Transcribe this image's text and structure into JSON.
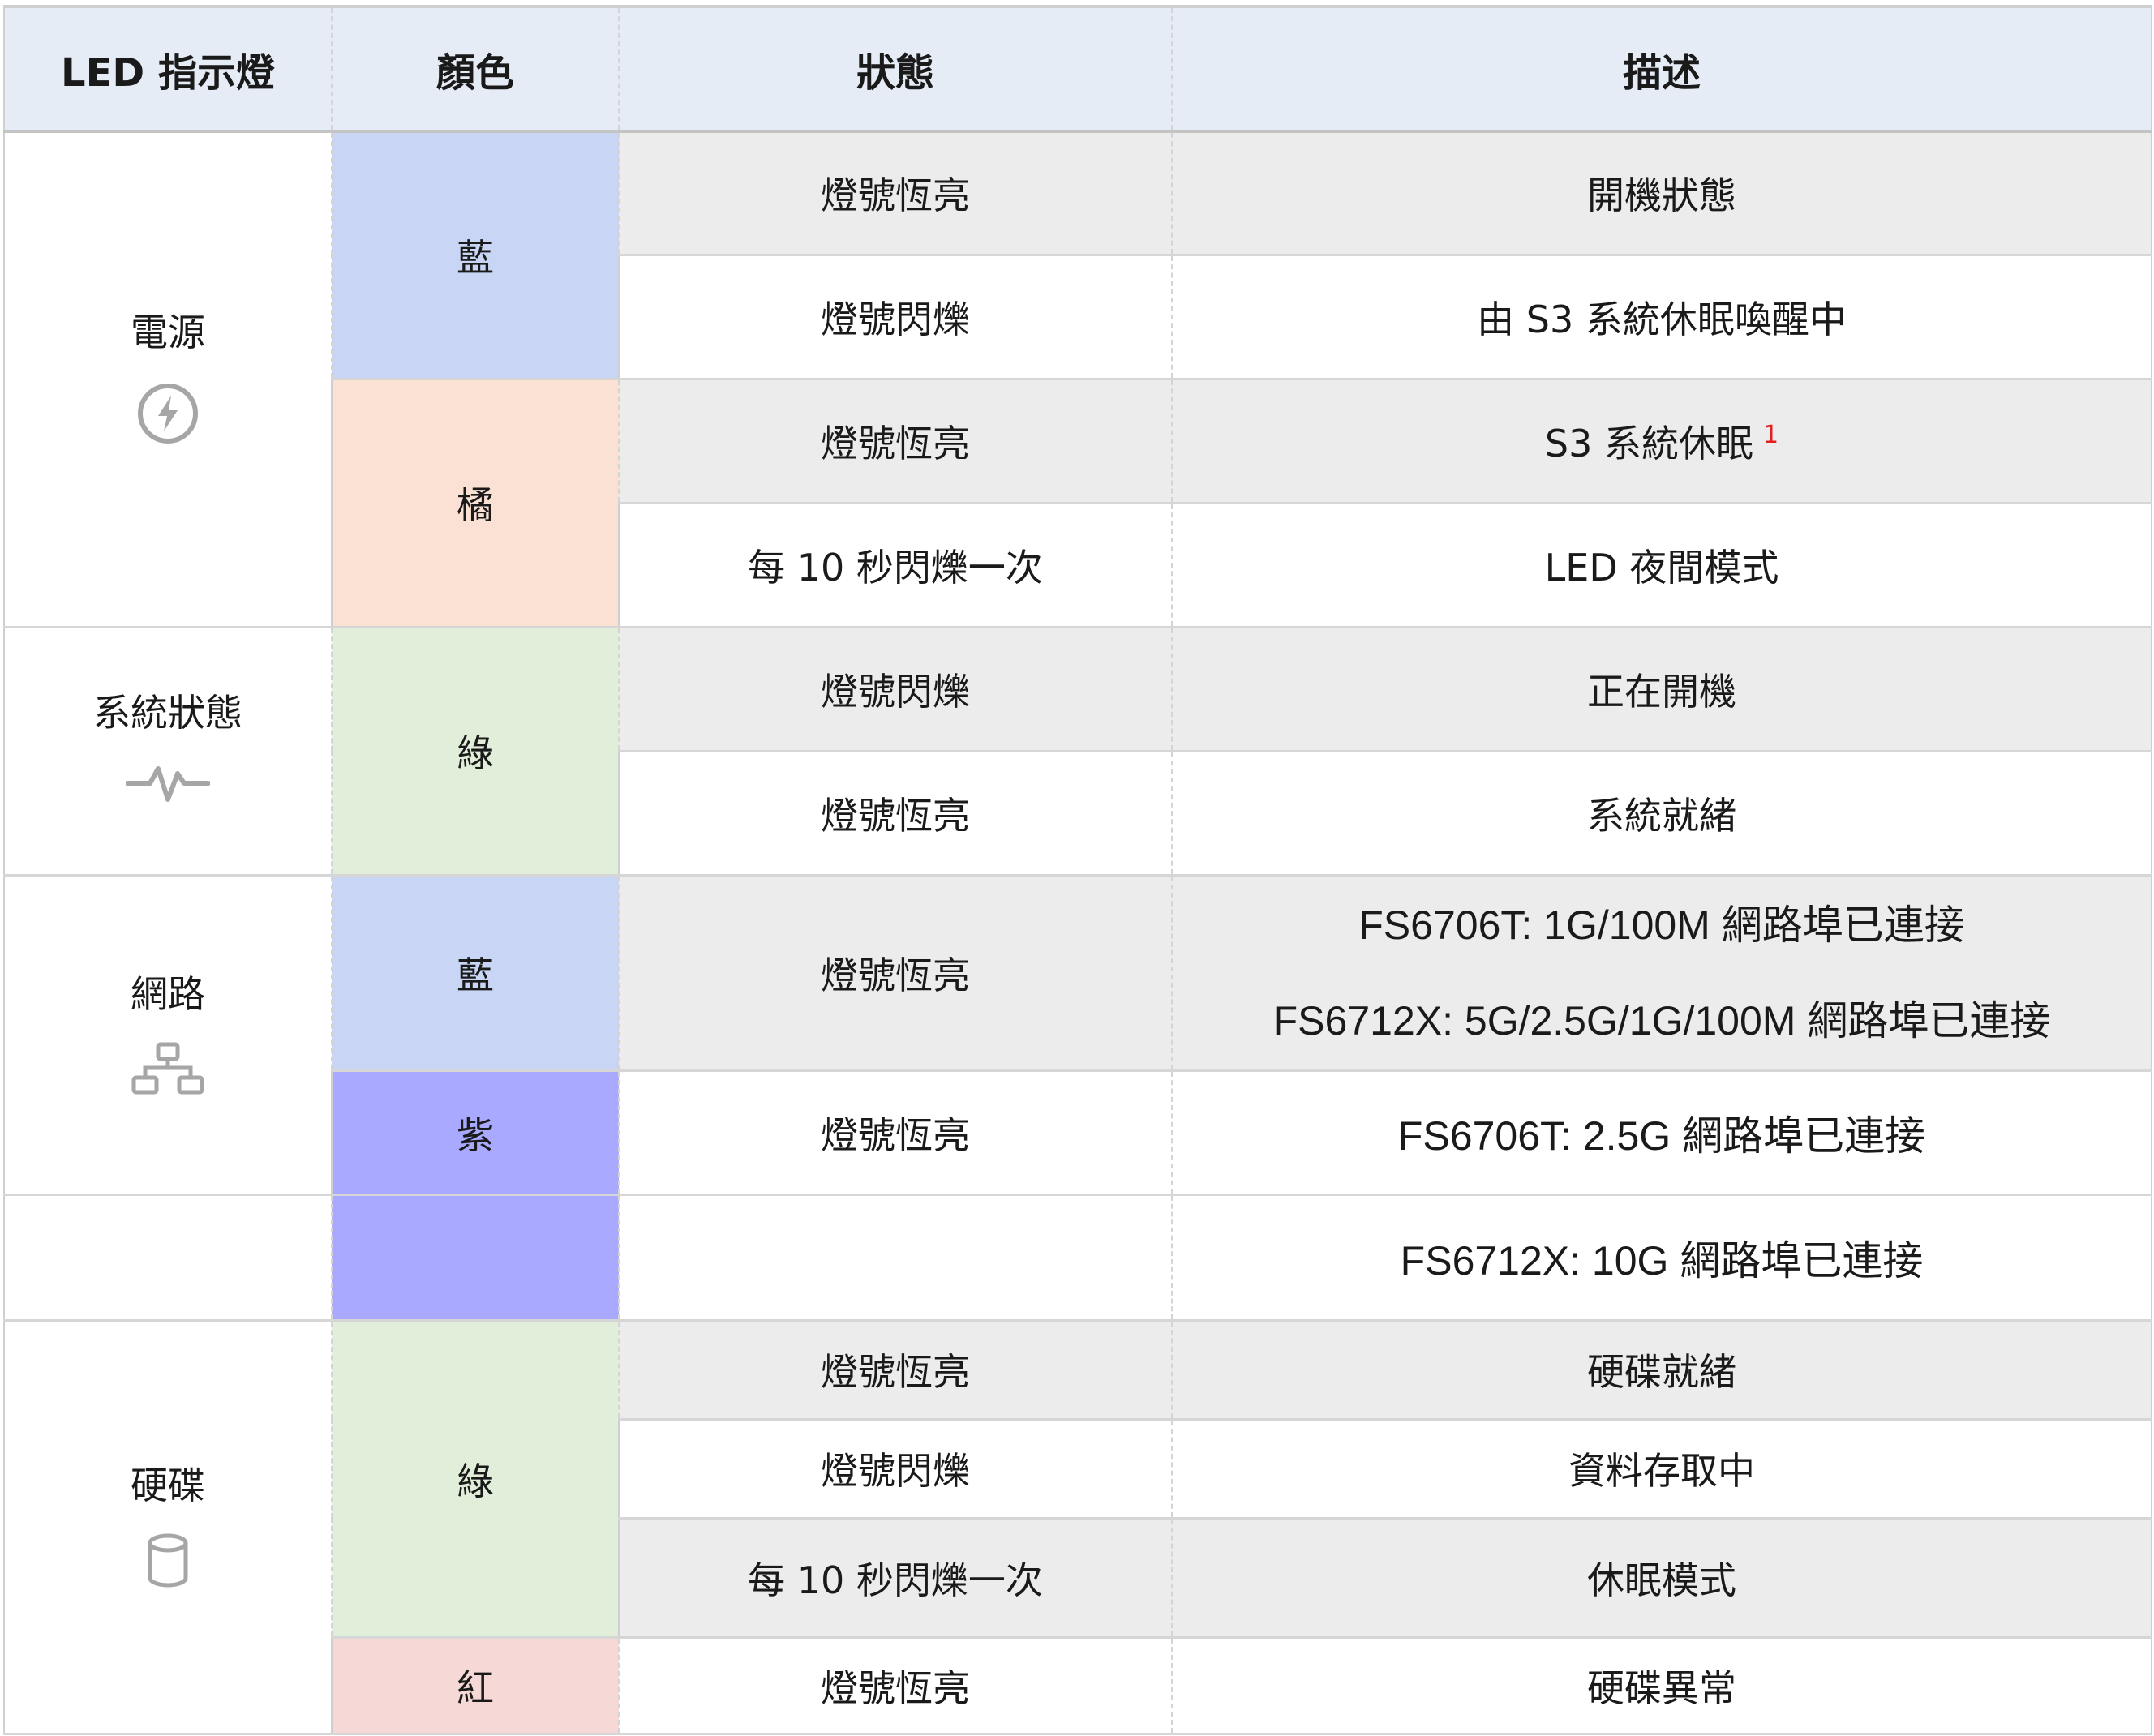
{
  "headers": {
    "led": "LED 指示燈",
    "color": "顏色",
    "status": "狀態",
    "description": "描述"
  },
  "groups": {
    "power": {
      "label": "電源",
      "icon": "power-icon",
      "colors": {
        "blue": "藍",
        "orange": "橘"
      },
      "rows": [
        {
          "status": "燈號恆亮",
          "description": "開機狀態"
        },
        {
          "status": "燈號閃爍",
          "description": "由 S3 系統休眠喚醒中"
        },
        {
          "status": "燈號恆亮",
          "description": "S3 系統休眠",
          "footnote": "1"
        },
        {
          "status": "每 10 秒閃爍一次",
          "description": "LED 夜間模式"
        }
      ]
    },
    "system": {
      "label": "系統狀態",
      "icon": "activity-pulse-icon",
      "colors": {
        "green": "綠"
      },
      "rows": [
        {
          "status": "燈號閃爍",
          "description": "正在開機"
        },
        {
          "status": "燈號恆亮",
          "description": "系統就緒"
        }
      ]
    },
    "network": {
      "label": "網路",
      "icon": "network-icon",
      "colors": {
        "blue": "藍",
        "purple": "紫"
      },
      "rows": [
        {
          "status": "燈號恆亮",
          "description_lines": [
            "FS6706T: 1G/100M 網路埠已連接",
            "FS6712X: 5G/2.5G/1G/100M 網路埠已連接"
          ]
        },
        {
          "status": "燈號恆亮",
          "description": "FS6706T: 2.5G 網路埠已連接"
        },
        {
          "status": "",
          "description": "FS6712X: 10G 網路埠已連接"
        }
      ]
    },
    "disk": {
      "label": "硬碟",
      "icon": "disk-cylinder-icon",
      "colors": {
        "green": "綠",
        "red": "紅"
      },
      "rows": [
        {
          "status": "燈號恆亮",
          "description": "硬碟就緒"
        },
        {
          "status": "燈號閃爍",
          "description": "資料存取中"
        },
        {
          "status": "每 10 秒閃爍一次",
          "description": "休眠模式"
        },
        {
          "status": "燈號恆亮",
          "description": "硬碟異常"
        }
      ]
    }
  },
  "colors": {
    "header_bg": "#e6ecf6",
    "blue": "#c8d5f5",
    "orange": "#fbe1d4",
    "green": "#e1eed9",
    "purple": "#a8a9ff",
    "red": "#f6d9d7",
    "row_gray": "#ececec",
    "footnote": "#e02020"
  }
}
